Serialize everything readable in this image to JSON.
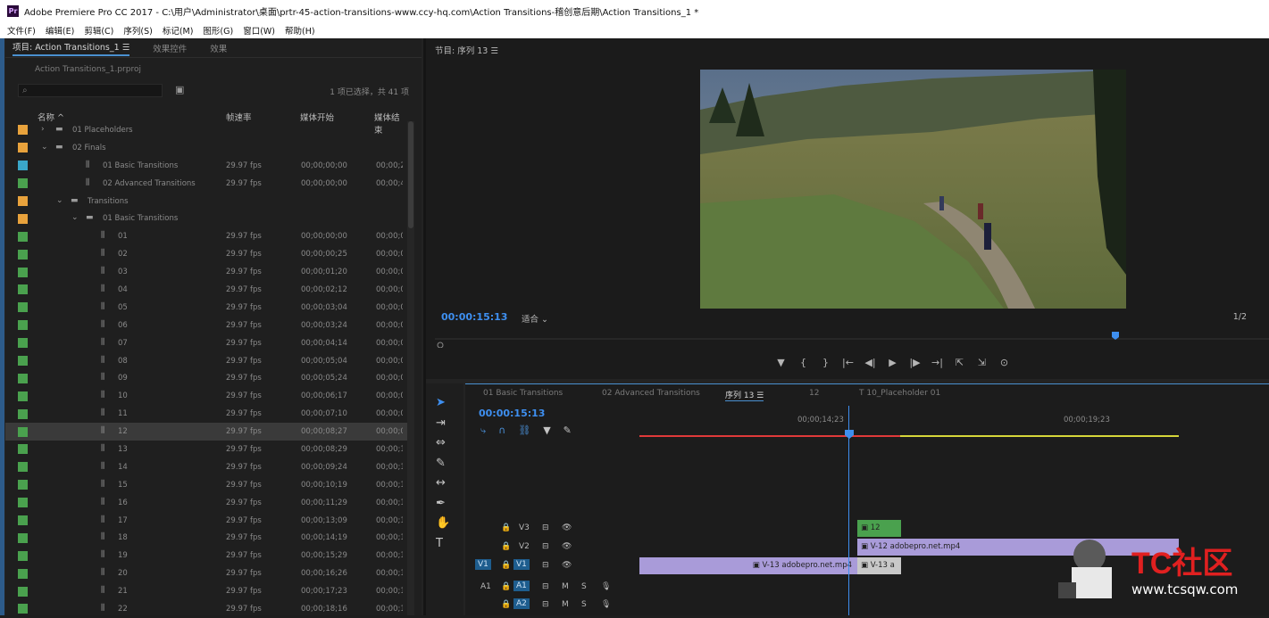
{
  "window": {
    "title": "Adobe Premiere Pro CC 2017 - C:\\用户\\Administrator\\桌面\\prtr-45-action-transitions-www.ccy-hq.com\\Action Transitions-稽创意后期\\Action Transitions_1 *"
  },
  "menu": [
    "文件(F)",
    "编辑(E)",
    "剪辑(C)",
    "序列(S)",
    "标记(M)",
    "图形(G)",
    "窗口(W)",
    "帮助(H)"
  ],
  "project": {
    "tabs": [
      "项目: Action Transitions_1 ☰",
      "效果控件",
      "效果"
    ],
    "file": "Action Transitions_1.prproj",
    "selection": "1 项已选择，共 41 项",
    "columns": {
      "name": "名称 ^",
      "fps": "帧速率",
      "start": "媒体开始",
      "end": "媒体结束"
    },
    "rows": [
      {
        "name": "01 Placeholders",
        "fps": "",
        "start": "",
        "end": "",
        "indent": 0,
        "kind": "folder-closed",
        "color": "#e8a23c"
      },
      {
        "name": "02 Finals",
        "fps": "",
        "start": "",
        "end": "",
        "indent": 0,
        "kind": "folder-open",
        "color": "#e8a23c"
      },
      {
        "name": "01 Basic Transitions",
        "fps": "29.97 fps",
        "start": "00;00;00;00",
        "end": "00;00;2",
        "indent": 2,
        "kind": "seq",
        "color": "#3aa7c9"
      },
      {
        "name": "02 Advanced Transitions",
        "fps": "29.97 fps",
        "start": "00;00;00;00",
        "end": "00;00;4",
        "indent": 2,
        "kind": "seq",
        "color": "#4aa14e"
      },
      {
        "name": "Transitions",
        "fps": "",
        "start": "",
        "end": "",
        "indent": 1,
        "kind": "folder-open",
        "color": "#e8a23c"
      },
      {
        "name": "01 Basic Transitions",
        "fps": "",
        "start": "",
        "end": "",
        "indent": 2,
        "kind": "folder-open",
        "color": "#e8a23c"
      },
      {
        "name": "01",
        "fps": "29.97 fps",
        "start": "00;00;00;00",
        "end": "00;00;0",
        "indent": 3,
        "kind": "seq",
        "color": "#4aa14e"
      },
      {
        "name": "02",
        "fps": "29.97 fps",
        "start": "00;00;00;25",
        "end": "00;00;0",
        "indent": 3,
        "kind": "seq",
        "color": "#4aa14e"
      },
      {
        "name": "03",
        "fps": "29.97 fps",
        "start": "00;00;01;20",
        "end": "00;00;0",
        "indent": 3,
        "kind": "seq",
        "color": "#4aa14e"
      },
      {
        "name": "04",
        "fps": "29.97 fps",
        "start": "00;00;02;12",
        "end": "00;00;0",
        "indent": 3,
        "kind": "seq",
        "color": "#4aa14e"
      },
      {
        "name": "05",
        "fps": "29.97 fps",
        "start": "00;00;03;04",
        "end": "00;00;0",
        "indent": 3,
        "kind": "seq",
        "color": "#4aa14e"
      },
      {
        "name": "06",
        "fps": "29.97 fps",
        "start": "00;00;03;24",
        "end": "00;00;0",
        "indent": 3,
        "kind": "seq",
        "color": "#4aa14e"
      },
      {
        "name": "07",
        "fps": "29.97 fps",
        "start": "00;00;04;14",
        "end": "00;00;0",
        "indent": 3,
        "kind": "seq",
        "color": "#4aa14e"
      },
      {
        "name": "08",
        "fps": "29.97 fps",
        "start": "00;00;05;04",
        "end": "00;00;0",
        "indent": 3,
        "kind": "seq",
        "color": "#4aa14e"
      },
      {
        "name": "09",
        "fps": "29.97 fps",
        "start": "00;00;05;24",
        "end": "00;00;0",
        "indent": 3,
        "kind": "seq",
        "color": "#4aa14e"
      },
      {
        "name": "10",
        "fps": "29.97 fps",
        "start": "00;00;06;17",
        "end": "00;00;0",
        "indent": 3,
        "kind": "seq",
        "color": "#4aa14e"
      },
      {
        "name": "11",
        "fps": "29.97 fps",
        "start": "00;00;07;10",
        "end": "00;00;0",
        "indent": 3,
        "kind": "seq",
        "color": "#4aa14e"
      },
      {
        "name": "12",
        "fps": "29.97 fps",
        "start": "00;00;08;27",
        "end": "00;00;0",
        "indent": 3,
        "kind": "seq",
        "color": "#4aa14e",
        "selected": true
      },
      {
        "name": "13",
        "fps": "29.97 fps",
        "start": "00;00;08;29",
        "end": "00;00;1",
        "indent": 3,
        "kind": "seq",
        "color": "#4aa14e"
      },
      {
        "name": "14",
        "fps": "29.97 fps",
        "start": "00;00;09;24",
        "end": "00;00;1",
        "indent": 3,
        "kind": "seq",
        "color": "#4aa14e"
      },
      {
        "name": "15",
        "fps": "29.97 fps",
        "start": "00;00;10;19",
        "end": "00;00;1",
        "indent": 3,
        "kind": "seq",
        "color": "#4aa14e"
      },
      {
        "name": "16",
        "fps": "29.97 fps",
        "start": "00;00;11;29",
        "end": "00;00;1",
        "indent": 3,
        "kind": "seq",
        "color": "#4aa14e"
      },
      {
        "name": "17",
        "fps": "29.97 fps",
        "start": "00;00;13;09",
        "end": "00;00;1",
        "indent": 3,
        "kind": "seq",
        "color": "#4aa14e"
      },
      {
        "name": "18",
        "fps": "29.97 fps",
        "start": "00;00;14;19",
        "end": "00;00;1",
        "indent": 3,
        "kind": "seq",
        "color": "#4aa14e"
      },
      {
        "name": "19",
        "fps": "29.97 fps",
        "start": "00;00;15;29",
        "end": "00;00;1",
        "indent": 3,
        "kind": "seq",
        "color": "#4aa14e"
      },
      {
        "name": "20",
        "fps": "29.97 fps",
        "start": "00;00;16;26",
        "end": "00;00;1",
        "indent": 3,
        "kind": "seq",
        "color": "#4aa14e"
      },
      {
        "name": "21",
        "fps": "29.97 fps",
        "start": "00;00;17;23",
        "end": "00;00;1",
        "indent": 3,
        "kind": "seq",
        "color": "#4aa14e"
      },
      {
        "name": "22",
        "fps": "29.97 fps",
        "start": "00;00;18;16",
        "end": "00;00;1",
        "indent": 3,
        "kind": "seq",
        "color": "#4aa14e"
      }
    ]
  },
  "program": {
    "tab": "节目: 序列 13 ☰",
    "timecode": "00:00:15:13",
    "fit": "适合",
    "ratio": "1/2",
    "transport": [
      "▼",
      "{",
      "}",
      "|←",
      "◀|",
      "▶",
      "|▶",
      "→|",
      "⇱",
      "⇲",
      "⊙"
    ]
  },
  "timeline": {
    "tabs": [
      "01 Basic Transitions",
      "02 Advanced Transitions",
      "序列 13 ☰",
      "12",
      "T 10_Placeholder 01"
    ],
    "timecode": "00:00:15:13",
    "ruler_labels": [
      "00;00;14;23",
      "00;00;19;23"
    ],
    "tracks": [
      {
        "name": "V3"
      },
      {
        "name": "V2"
      },
      {
        "name": "V1",
        "source": "V1"
      },
      {
        "name": "A1",
        "source": "A1"
      },
      {
        "name": "A2"
      }
    ],
    "clips": {
      "v3": "12",
      "v2": "V-12 adobepro.net.mp4",
      "v1a": "V-13 adobepro.net.mp4",
      "v1b": "V-13 a"
    }
  },
  "watermark": {
    "brand": "TC社区",
    "url": "www.tcsqw.com"
  },
  "colors": {
    "accent": "#3e8ff0",
    "clip_purple": "#a99bd9",
    "clip_green": "#4aa14e",
    "label_orange": "#e8a23c",
    "label_green": "#4aa14e"
  }
}
